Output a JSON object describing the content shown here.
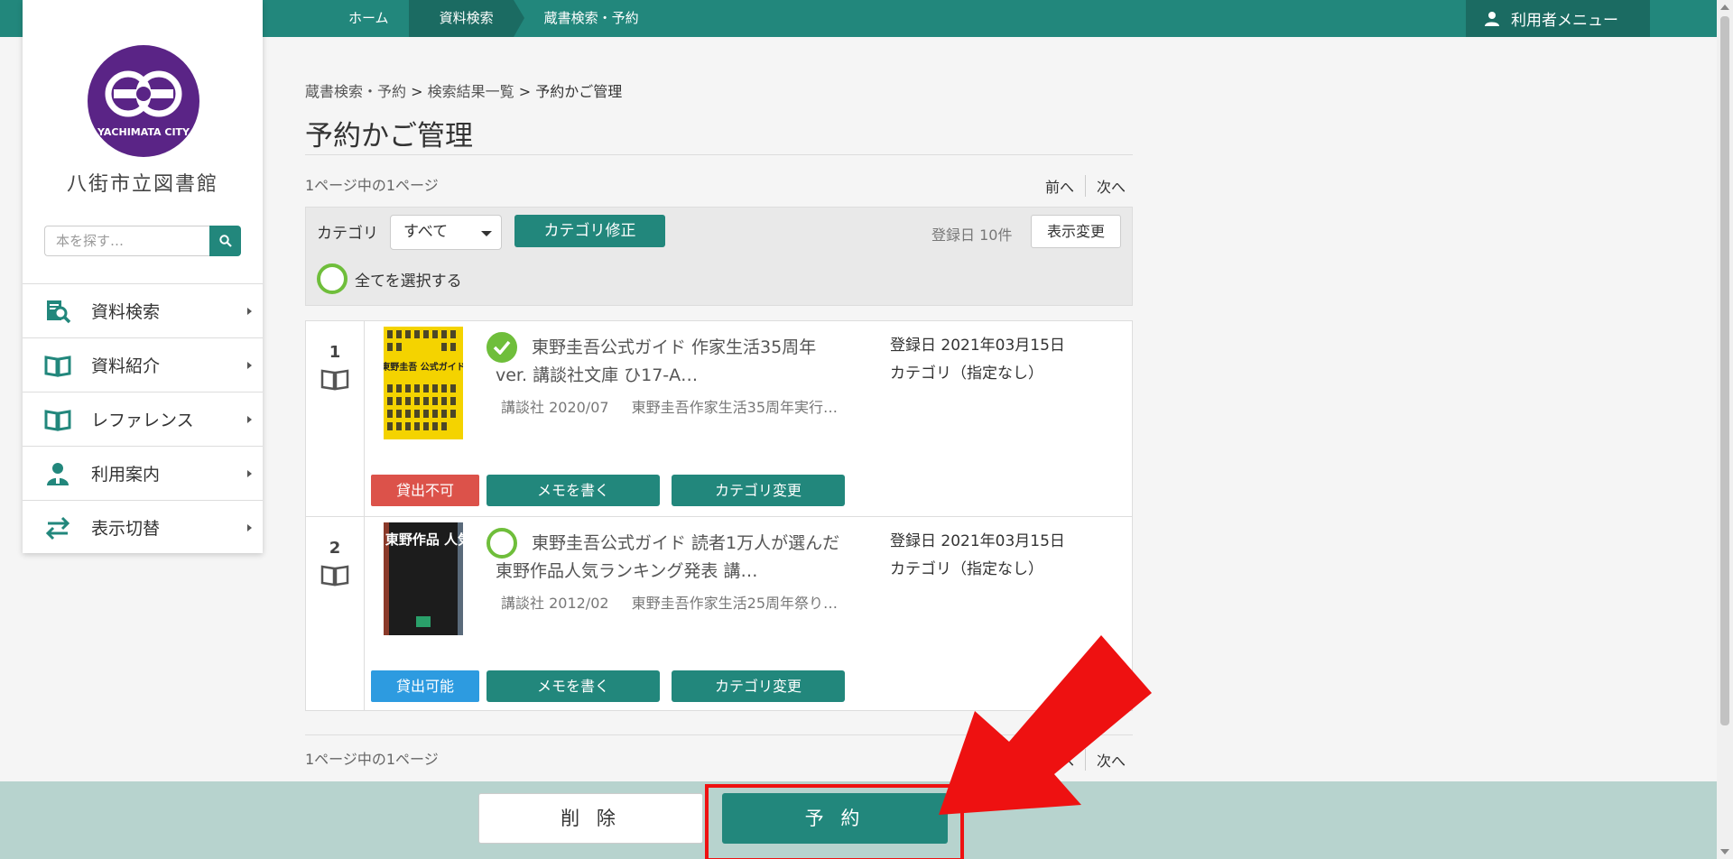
{
  "topbar": {
    "crumbs": [
      "ホーム",
      "資料検索",
      "蔵書検索・予約"
    ],
    "user_menu": "利用者メニュー"
  },
  "sidebar": {
    "logo_text": "YACHIMATA CITY",
    "library_name": "八街市立図書館",
    "search_placeholder": "本を探す…",
    "items": [
      {
        "label": "資料検索",
        "icon": "catalog-search-icon"
      },
      {
        "label": "資料紹介",
        "icon": "open-book-icon"
      },
      {
        "label": "レファレンス",
        "icon": "open-book-icon"
      },
      {
        "label": "利用案内",
        "icon": "user-guide-icon"
      },
      {
        "label": "表示切替",
        "icon": "switch-arrows-icon"
      }
    ]
  },
  "breadcrumb": {
    "items": [
      "蔵書検索・予約",
      "検索結果一覧",
      "予約かご管理"
    ],
    "separator": ">"
  },
  "page_title": "予約かご管理",
  "pagination": {
    "info": "1ページ中の1ページ",
    "prev": "前へ",
    "next": "次へ"
  },
  "toolbar": {
    "category_label": "カテゴリ",
    "category_value": "すべて",
    "category_fix_button": "カテゴリ修正",
    "sort_info": "登録日 10件",
    "display_change_button": "表示変更",
    "select_all_label": "全てを選択する"
  },
  "results": [
    {
      "number": "1",
      "checked": true,
      "title": "東野圭吾公式ガイド 作家生活35周年ver. 講談社文庫 ひ17-A…",
      "publisher": "講談社 2020/07",
      "series": "東野圭吾作家生活35周年実行…",
      "registered": "登録日 2021年03月15日",
      "category": "カテゴリ（指定なし）",
      "status": "貸出不可",
      "memo_button": "メモを書く",
      "category_change_button": "カテゴリ変更"
    },
    {
      "number": "2",
      "checked": false,
      "title": "東野圭吾公式ガイド 読者1万人が選んだ東野作品人気ランキング発表 講…",
      "publisher": "講談社 2012/02",
      "series": "東野圭吾作家生活25周年祭り…",
      "registered": "登録日 2021年03月15日",
      "category": "カテゴリ（指定なし）",
      "status": "貸出可能",
      "memo_button": "メモを書く",
      "category_change_button": "カテゴリ変更"
    }
  ],
  "cover_texts": {
    "cover1": "東野圭吾 公式ガイド",
    "cover2": "東野圭吾 ガイド 東野作品 人気ランキング発表"
  },
  "actions": {
    "delete_button": "削 除",
    "reserve_button": "予 約"
  },
  "colors": {
    "brand": "#22877c",
    "brand_dark": "#1b6b62",
    "unavailable": "#dc524a",
    "available": "#2d9be0",
    "checkmark": "#6fbe3b",
    "highlight": "#ee1111"
  }
}
